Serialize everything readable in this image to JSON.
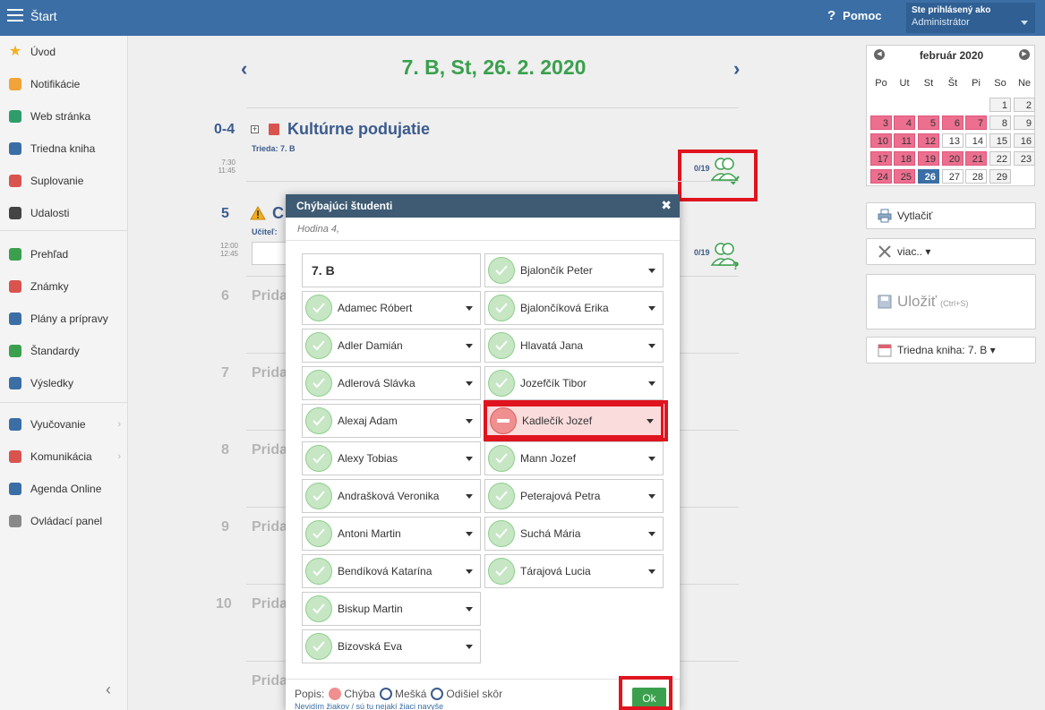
{
  "topbar": {
    "title": "Štart",
    "help": "Pomoc",
    "user_label": "Ste prihlásený ako",
    "user_name": "Administrátor"
  },
  "sidebar": {
    "items": [
      {
        "label": "Úvod",
        "icon": "star-icon"
      },
      {
        "label": "Notifikácie",
        "icon": "envelope-icon"
      },
      {
        "label": "Web stránka",
        "icon": "home-icon"
      },
      {
        "label": "Triedna kniha",
        "icon": "book-icon"
      },
      {
        "label": "Suplovanie",
        "icon": "person-icon"
      },
      {
        "label": "Udalosti",
        "icon": "calendar-icon"
      },
      {
        "label": "Prehľad",
        "icon": "check-circle-icon"
      },
      {
        "label": "Známky",
        "icon": "grades-icon"
      },
      {
        "label": "Plány a prípravy",
        "icon": "briefcase-icon"
      },
      {
        "label": "Štandardy",
        "icon": "shield-icon"
      },
      {
        "label": "Výsledky",
        "icon": "bar-chart-icon"
      },
      {
        "label": "Vyučovanie",
        "icon": "book-open-icon"
      },
      {
        "label": "Komunikácia",
        "icon": "chat-icon"
      },
      {
        "label": "Agenda Online",
        "icon": "pen-icon"
      },
      {
        "label": "Ovládací panel",
        "icon": "gear-icon"
      }
    ]
  },
  "main": {
    "title": "7. B, St, 26. 2. 2020",
    "lessons": [
      {
        "num": "0-4",
        "time_start": "7:30",
        "time_end": "11:45",
        "title": "Kultúrne podujatie",
        "label": "Trieda:",
        "label_value": "7. B",
        "count": "0/19"
      },
      {
        "num": "5",
        "time_start": "12:00",
        "time_end": "12:45",
        "title": "C",
        "label": "Učiteľ:",
        "count": "0/19"
      }
    ],
    "add_rows": [
      {
        "num": "6",
        "text": "Prida"
      },
      {
        "num": "7",
        "text": "Prida"
      },
      {
        "num": "8",
        "text": "Prida"
      },
      {
        "num": "9",
        "text": "Prida"
      },
      {
        "num": "10",
        "text": "Prida"
      },
      {
        "num": "",
        "text": "Prida"
      }
    ]
  },
  "calendar": {
    "month": "február 2020",
    "dow": [
      "Po",
      "Ut",
      "St",
      "Št",
      "Pi",
      "So",
      "Ne"
    ],
    "colors": {
      "pink": "#ec6f8f",
      "today": "#3b6ea5"
    }
  },
  "right_buttons": {
    "print": "Vytlačiť",
    "more": "viac.. ▾",
    "save": "Uložiť",
    "save_hint": "(Ctrl+S)",
    "class_book": "Triedna kniha: 7. B ▾"
  },
  "modal": {
    "title": "Chýbajúci študenti",
    "subtitle": "Hodina 4,",
    "class_name": "7. B",
    "left_students": [
      "Adamec Róbert",
      "Adler Damián",
      "Adlerová Slávka",
      "Alexaj Adam",
      "Alexy Tobias",
      "Andrašková Veronika",
      "Antoni Martin",
      "Bendíková Katarína",
      "Biskup Martin",
      "Bizovská Eva"
    ],
    "right_students": [
      "Bjalončík Peter",
      "Bjalončíková Erika",
      "Hlavatá Jana",
      "Jozefčík Tibor",
      "Kadlečík Jozef",
      "Mann Jozef",
      "Peterajová Petra",
      "Suchá Mária",
      "Tárajová Lucia"
    ],
    "absent_student": "Kadlečík Jozef",
    "legend": {
      "prefix": "Popis:",
      "absent": "Chýba",
      "late": "Mešká",
      "left": "Odišiel skôr"
    },
    "link": "Nevidím žiakov / sú tu nejakí žiaci navyše",
    "ok": "Ok"
  }
}
